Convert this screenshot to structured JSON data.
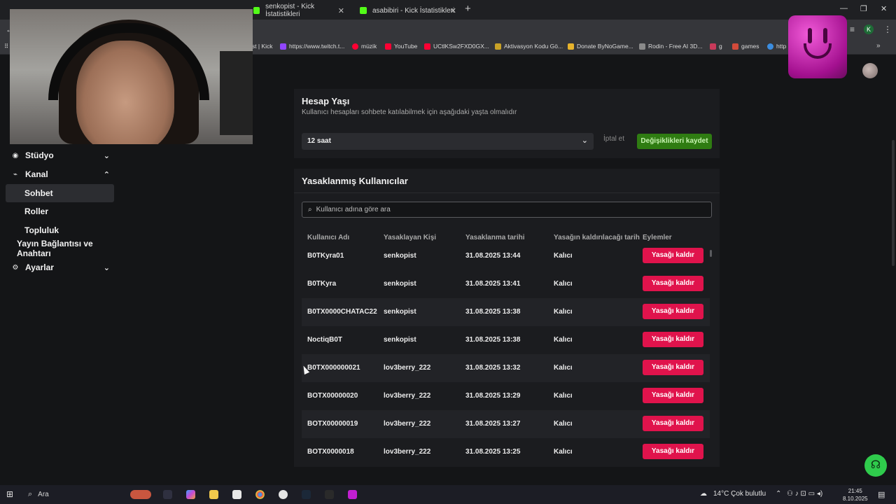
{
  "browser": {
    "tabs": [
      {
        "label": "senkopist - Kick İstatistikleri",
        "active": false
      },
      {
        "label": "asabibiri - Kick İstatistikleri",
        "active": false
      }
    ],
    "bookmarks": [
      {
        "label": "ist | Kick",
        "color": "#53fc18"
      },
      {
        "label": "https://www.twitch.t...",
        "color": "#9146ff"
      },
      {
        "label": "müzik",
        "color": "#ff0033"
      },
      {
        "label": "YouTube",
        "color": "#ff0033"
      },
      {
        "label": "UCtlKSw2FXD0GX...",
        "color": "#ff0033"
      },
      {
        "label": "Aktivasyon Kodu Gö...",
        "color": "#c9a227"
      },
      {
        "label": "Donate ByNoGame...",
        "color": "#e7b32c"
      },
      {
        "label": "Rodin - Free AI 3D...",
        "color": "#8a8a8a"
      },
      {
        "label": "g",
        "color": "#c83a5a"
      },
      {
        "label": "games",
        "color": "#d24a3a"
      },
      {
        "label": "http",
        "color": "#3b8de0"
      }
    ],
    "profile_letter": "K"
  },
  "sidebar": {
    "items": [
      {
        "label": "Stüdyo",
        "icon": "studio-icon",
        "expandable": "chevron-down"
      },
      {
        "label": "Kanal",
        "icon": "channel-icon",
        "expandable": "chevron-up"
      },
      {
        "label": "Sohbet",
        "active": true
      },
      {
        "label": "Roller"
      },
      {
        "label": "Topluluk"
      },
      {
        "label": "Yayın Bağlantısı ve Anahtarı"
      },
      {
        "label": "Ayarlar",
        "icon": "gear-icon",
        "expandable": "chevron-down"
      }
    ]
  },
  "account_age": {
    "title": "Hesap Yaşı",
    "description": "Kullanıcı hesapları sohbete katılabilmek için aşağıdaki yaşta olmalıdır",
    "selected": "12 saat",
    "cancel_label": "İptal et",
    "save_label": "Değişiklikleri kaydet"
  },
  "banned": {
    "title": "Yasaklanmış Kullanıcılar",
    "search_placeholder": "Kullanıcı adına göre ara",
    "columns": [
      "Kullanıcı Adı",
      "Yasaklayan Kişi",
      "Yasaklanma tarihi",
      "Yasağın kaldırılacağı tarih",
      "Eylemler"
    ],
    "rows": [
      {
        "user": "B0TKyra01",
        "by": "senkopist",
        "date": "31.08.2025 13:44",
        "until": "Kalıcı",
        "action": "Yasağı kaldır"
      },
      {
        "user": "B0TKyra",
        "by": "senkopist",
        "date": "31.08.2025 13:41",
        "until": "Kalıcı",
        "action": "Yasağı kaldır"
      },
      {
        "user": "B0TX0000CHATAC22",
        "by": "senkopist",
        "date": "31.08.2025 13:38",
        "until": "Kalıcı",
        "action": "Yasağı kaldır"
      },
      {
        "user": "NoctiqB0T",
        "by": "senkopist",
        "date": "31.08.2025 13:38",
        "until": "Kalıcı",
        "action": "Yasağı kaldır"
      },
      {
        "user": "B0TX000000021",
        "by": "lov3berry_222",
        "date": "31.08.2025 13:32",
        "until": "Kalıcı",
        "action": "Yasağı kaldır"
      },
      {
        "user": "BOTX00000020",
        "by": "lov3berry_222",
        "date": "31.08.2025 13:29",
        "until": "Kalıcı",
        "action": "Yasağı kaldır"
      },
      {
        "user": "BOTX00000019",
        "by": "lov3berry_222",
        "date": "31.08.2025 13:27",
        "until": "Kalıcı",
        "action": "Yasağı kaldır"
      },
      {
        "user": "BOTX0000018",
        "by": "lov3berry_222",
        "date": "31.08.2025 13:25",
        "until": "Kalıcı",
        "action": "Yasağı kaldır"
      }
    ]
  },
  "taskbar": {
    "search_label": "Ara",
    "weather": "14°C  Çok bulutlu",
    "time": "21:45",
    "date": "8.10.2025"
  },
  "colors": {
    "accent_green": "#53fc18",
    "save_button": "#2f7c12",
    "unban_button": "#e0134c",
    "background": "#141517",
    "card": "#1b1c1f"
  }
}
